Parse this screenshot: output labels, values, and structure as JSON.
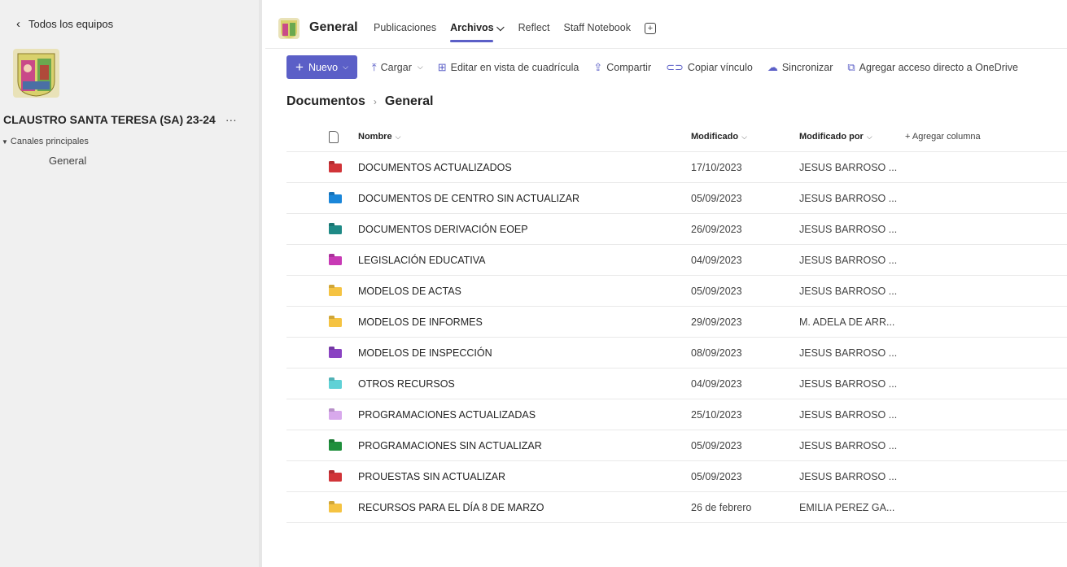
{
  "sidebar": {
    "back_label": "Todos los equipos",
    "team_name": "CLAUSTRO SANTA TERESA (SA) 23-24",
    "more_label": "···",
    "section_label": "Canales principales",
    "channels": [
      "General"
    ]
  },
  "header": {
    "channel_title": "General",
    "tabs": [
      {
        "label": "Publicaciones"
      },
      {
        "label": "Archivos ⌵"
      },
      {
        "label": "Reflect"
      },
      {
        "label": "Staff Notebook"
      }
    ],
    "add_tab_symbol": "+"
  },
  "toolbar": {
    "new_label": "Nuevo",
    "upload_label": "Cargar",
    "grid_label": "Editar en vista de cuadrícula",
    "share_label": "Compartir",
    "copy_link_label": "Copiar vínculo",
    "sync_label": "Sincronizar",
    "shortcut_label": "Agregar acceso directo a OneDrive"
  },
  "breadcrumb": {
    "root": "Documentos",
    "current": "General"
  },
  "table": {
    "columns": {
      "name": "Nombre",
      "modified": "Modificado",
      "modified_by": "Modificado por",
      "add_column": "+ Agregar columna"
    },
    "rows": [
      {
        "name": "DOCUMENTOS ACTUALIZADOS",
        "modified": "17/10/2023",
        "modified_by": "JESUS BARROSO ...",
        "color": "#d13438"
      },
      {
        "name": "DOCUMENTOS DE CENTRO SIN ACTUALIZAR",
        "modified": "05/09/2023",
        "modified_by": "JESUS BARROSO ...",
        "color": "#1a86d9"
      },
      {
        "name": "DOCUMENTOS DERIVACIÓN EOEP",
        "modified": "26/09/2023",
        "modified_by": "JESUS BARROSO ...",
        "color": "#1f8a86"
      },
      {
        "name": "LEGISLACIÓN EDUCATIVA",
        "modified": "04/09/2023",
        "modified_by": "JESUS BARROSO ...",
        "color": "#c83ab5"
      },
      {
        "name": "MODELOS DE ACTAS",
        "modified": "05/09/2023",
        "modified_by": "JESUS BARROSO ...",
        "color": "#f5c342"
      },
      {
        "name": "MODELOS DE INFORMES",
        "modified": "29/09/2023",
        "modified_by": "M. ADELA DE ARR...",
        "color": "#f5c342"
      },
      {
        "name": "MODELOS DE INSPECCIÓN",
        "modified": "08/09/2023",
        "modified_by": "JESUS BARROSO ...",
        "color": "#8a43c2"
      },
      {
        "name": "OTROS RECURSOS",
        "modified": "04/09/2023",
        "modified_by": "JESUS BARROSO ...",
        "color": "#5fd1d6"
      },
      {
        "name": "PROGRAMACIONES ACTUALIZADAS",
        "modified": "25/10/2023",
        "modified_by": "JESUS BARROSO ...",
        "color": "#d8a9ec"
      },
      {
        "name": "PROGRAMACIONES SIN ACTUALIZAR",
        "modified": "05/09/2023",
        "modified_by": "JESUS BARROSO ...",
        "color": "#1f8f3c"
      },
      {
        "name": "PROUESTAS SIN ACTUALIZAR",
        "modified": "05/09/2023",
        "modified_by": "JESUS BARROSO ...",
        "color": "#d13438"
      },
      {
        "name": "RECURSOS PARA EL DÍA 8 DE MARZO",
        "modified": "26 de febrero",
        "modified_by": "EMILIA PEREZ GA...",
        "color": "#f5c342"
      }
    ]
  },
  "colors": {
    "accent": "#5b5fc7"
  }
}
